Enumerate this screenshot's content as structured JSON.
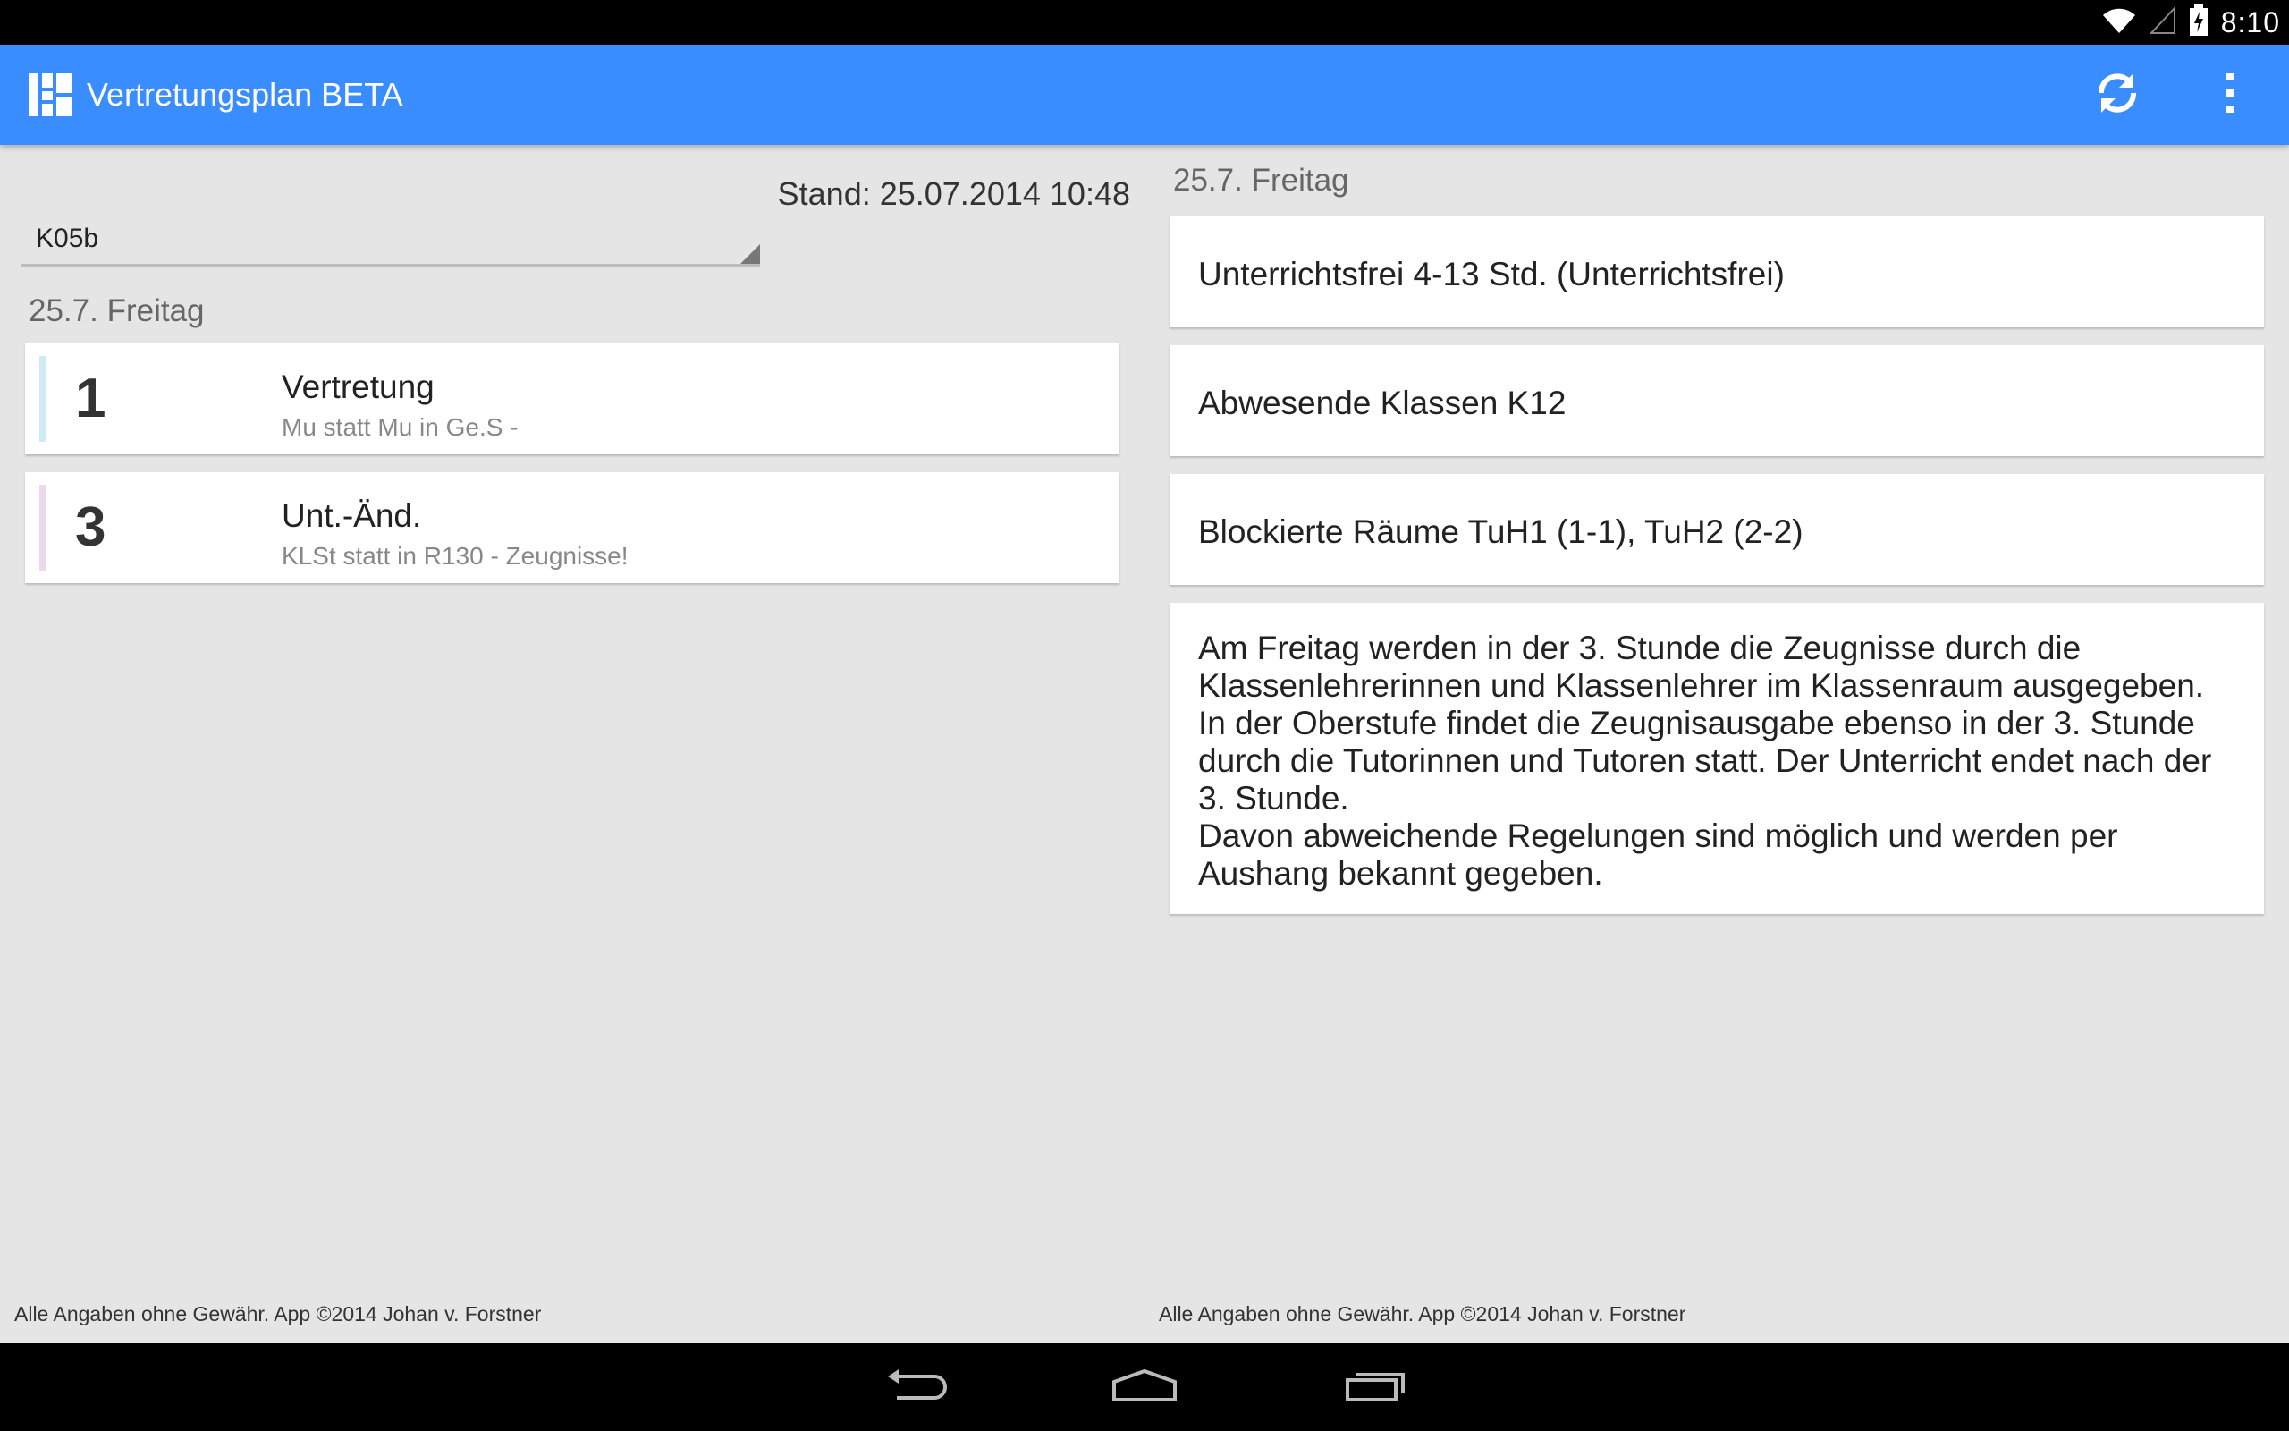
{
  "status_bar": {
    "time": "8:10",
    "icons": [
      "wifi-icon",
      "signal-icon",
      "battery-charging-icon"
    ]
  },
  "action_bar": {
    "title": "Vertretungsplan BETA",
    "color": "#3a8dff",
    "logo_icon": "app-grid-logo-icon",
    "actions": [
      "refresh-icon",
      "overflow-menu-icon"
    ]
  },
  "left": {
    "class_select": {
      "value": "K05b"
    },
    "stand": "Stand: 25.07.2014 10:48",
    "day_header": "25.7. Freitag",
    "entries": [
      {
        "hour": "1",
        "type": "Vertretung",
        "detail": "Mu statt Mu in Ge.S -",
        "color": "#cfeaf5"
      },
      {
        "hour": "3",
        "type": "Unt.-Änd.",
        "detail": "KLSt statt   in R130 - Zeugnisse!",
        "color": "#ecd9ee"
      }
    ],
    "footer": "Alle Angaben ohne Gewähr. App ©2014 Johan v. Forstner"
  },
  "right": {
    "day_header": "25.7. Freitag",
    "info": [
      "Unterrichtsfrei  4-13 Std. (Unterrichtsfrei)",
      "Abwesende Klassen  K12",
      "Blockierte Räume  TuH1 (1-1), TuH2 (2-2)"
    ],
    "message": "Am Freitag werden in der 3. Stunde die Zeugnisse durch die Klassenlehrerinnen und Klassenlehrer im Klassenraum ausgegeben. In der Oberstufe findet die Zeugnisausgabe ebenso in der 3. Stunde durch die Tutorinnen und Tutoren statt. Der Unterricht endet nach der 3. Stunde.\nDavon abweichende Regelungen sind möglich und werden per Aushang bekannt gegeben.",
    "footer": "Alle Angaben ohne Gewähr. App ©2014 Johan v. Forstner"
  },
  "nav_bar": {
    "buttons": [
      "back-icon",
      "home-icon",
      "recent-apps-icon"
    ]
  }
}
